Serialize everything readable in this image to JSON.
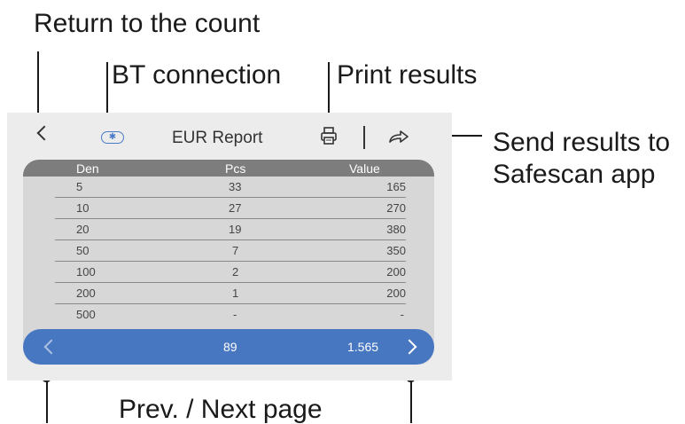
{
  "callouts": {
    "return": "Return to the count",
    "bt": "BT connection",
    "print": "Print results",
    "send_line1": "Send results to",
    "send_line2": "Safescan app",
    "prevnext": "Prev. / Next page"
  },
  "screen": {
    "title": "EUR  Report",
    "bt_symbol": "✱",
    "table": {
      "headers": [
        "Den",
        "Pcs",
        "Value"
      ],
      "rows": [
        [
          "5",
          "33",
          "165"
        ],
        [
          "10",
          "27",
          "270"
        ],
        [
          "20",
          "19",
          "380"
        ],
        [
          "50",
          "7",
          "350"
        ],
        [
          "100",
          "2",
          "200"
        ],
        [
          "200",
          "1",
          "200"
        ],
        [
          "500",
          "-",
          "-"
        ]
      ]
    },
    "totals": {
      "pcs": "89",
      "value": "1.565"
    }
  },
  "colors": {
    "accent": "#4877c2",
    "header": "#7d7d7d",
    "panel": "#d7d7d7",
    "screen_bg": "#ececec"
  },
  "icons": [
    "back-icon",
    "bluetooth-icon",
    "print-icon",
    "share-icon",
    "chevron-left-icon",
    "chevron-right-icon"
  ]
}
